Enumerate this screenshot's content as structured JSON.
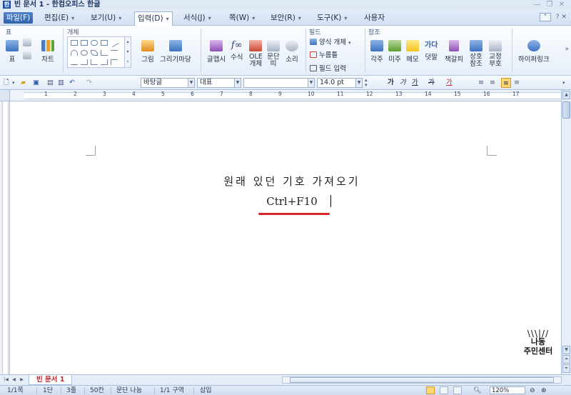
{
  "window": {
    "title": "빈 문서 1 - 한컴오피스 한글"
  },
  "menu": {
    "items": [
      "파일(F)",
      "편집(E)",
      "보기(U)",
      "입력(D)",
      "서식(J)",
      "쪽(W)",
      "보안(R)",
      "도구(K)",
      "사용자"
    ],
    "active": "입력(D)",
    "help": "?"
  },
  "ribbon": {
    "group_labels": [
      "표",
      "개체",
      "필드",
      "참조"
    ],
    "table_label": "표",
    "chart_label": "차트",
    "picture_label": "그림",
    "drawing_market_label": "그리기마당",
    "glyph_label": "글맵시",
    "equation_label": "수식",
    "ole_label": "OLE\n개체",
    "paragraph_label": "문단\n띠",
    "sound_label": "소리",
    "form_object_label": "양식 개체",
    "click_here_label": "누름틀",
    "field_input_label": "필드 입력",
    "footnote_label": "각주",
    "endnote_label": "미주",
    "memo_label": "메모",
    "overlay_label": "덧말",
    "bookmark_label": "책갈피",
    "cross_reference_label": "상호\n참조",
    "proofreading_mark_label": "교정\n부호",
    "hyperlink_label": "하이퍼링크",
    "overlay_icon_text": "가다"
  },
  "format_bar": {
    "style_value": "바탕글",
    "language_value": "대표",
    "font_value": "",
    "size_value": "14.0",
    "size_unit": "pt",
    "bold": "가",
    "italic": "가",
    "underline": "가",
    "strike": "가",
    "font_color": "가"
  },
  "ruler": {
    "numbers": [
      "1",
      "2",
      "3",
      "4",
      "5",
      "6",
      "7",
      "8",
      "9",
      "10",
      "11",
      "12",
      "13",
      "14",
      "15",
      "16",
      "17"
    ]
  },
  "document": {
    "line1": "원래 있던 기호 가져오기",
    "line2": "Ctrl+F10",
    "underline_color": "#d9262c"
  },
  "tabs": {
    "doc_tab": "빈 문서 1"
  },
  "status": {
    "page": "1/1쪽",
    "column": "1단",
    "line": "3줄",
    "char": "50칸",
    "paragraph_break": "문단 나눔",
    "section": "1/1 구역",
    "insert_mode": "삽입",
    "zoom": "120%"
  },
  "watermark": {
    "line1": "나동",
    "line2": "주민센터"
  },
  "colors": {
    "accent": "#2d62b0",
    "ribbon_bg": "#e6eef9",
    "highlight": "#fcd774"
  }
}
